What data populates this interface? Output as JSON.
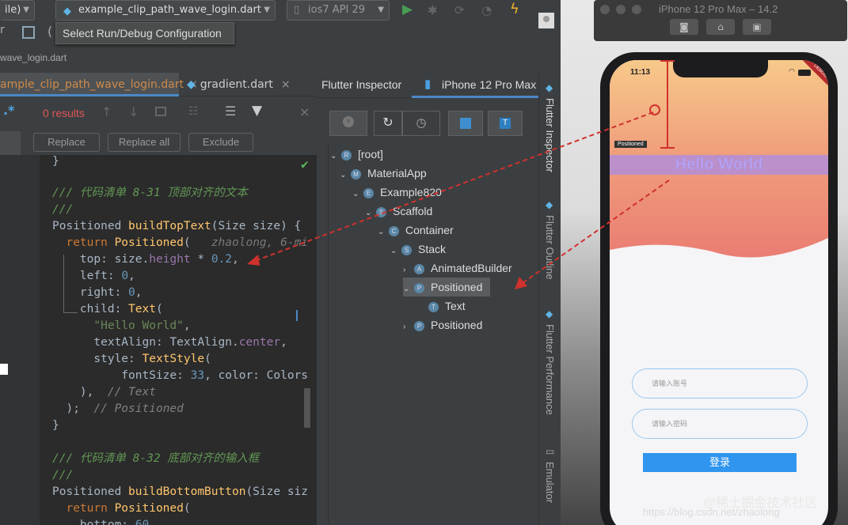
{
  "toolbar": {
    "run_config_label": "ile)",
    "file_combo": "example_clip_path_wave_login.dart",
    "device_combo": "ios7 API 29",
    "tooltip": "Select Run/Debug Configuration"
  },
  "breadcrumb": "wave_login.dart",
  "editor_tabs": [
    "ample_clip_path_wave_login.dart",
    "gradient.dart"
  ],
  "find": {
    "results": "0 results",
    "replace": "Replace",
    "replace_all": "Replace all",
    "exclude": "Exclude"
  },
  "code": {
    "l0": "}",
    "l1": "/// 代码清单 8-31 顶部对齐的文本",
    "l2": "///",
    "l3a": "Positioned ",
    "l3b": "buildTopText",
    "l3c": "(Size size) {",
    "l4a": "  return ",
    "l4b": "Positioned",
    "l4c": "(   ",
    "l4d": "zhaolong, 6-mi",
    "l5a": "    top: ",
    "l5b": "size.",
    "l5c": "height",
    " l5d": " * ",
    "l5e": "0.2",
    ",": ",",
    "l6a": "    left: ",
    "l6b": "0",
    "l7a": "    right: ",
    "l7b": "0",
    "l8a": "    child: ",
    "l8b": "Text",
    "l8c": "(",
    "l9": "      \"Hello World\"",
    "l10a": "      textAlign: TextAlign.",
    "l10b": "center",
    "l11a": "      style: ",
    "l11b": "TextStyle",
    "l11c": "(",
    "l12a": "          fontSize: ",
    "l12b": "33",
    ", color: Colors": "",
    "l13a": "    ),  ",
    "l13b": "// Text",
    "l14a": "  );  ",
    "l14b": "// Positioned",
    "l15": "}",
    "l16": "/// 代码清单 8-32 底部对齐的输入框",
    "l17": "///",
    "l18a": "Positioned ",
    "l18b": "buildBottomButton",
    "l18c": "(Size siz",
    "l19a": "  return ",
    "l19b": "Positioned",
    "l19c": "(",
    "l20a": "    bottom: ",
    "l20b": "60"
  },
  "inspector": {
    "tab1": "Flutter Inspector",
    "tab2": "iPhone 12 Pro Max",
    "tree": [
      "[root]",
      "MaterialApp",
      "Example820",
      "Scaffold",
      "Container",
      "Stack",
      "AnimatedBuilder",
      "Positioned",
      "Text",
      "Positioned"
    ],
    "icons": [
      "R",
      "M",
      "E",
      "S",
      "C",
      "S",
      "A",
      "P",
      "T",
      "P"
    ]
  },
  "side_tabs": [
    "Flutter Inspector",
    "Flutter Outline",
    "Flutter Performance",
    "Emulator"
  ],
  "simulator": {
    "title": "iPhone 12 Pro Max – 14.2",
    "time": "11:13",
    "debug": "DEBUG",
    "positioned_tag": "Positioned",
    "hello": "Hello World",
    "account_placeholder": "请输入账号",
    "password_placeholder": "请输入密码",
    "login": "登录",
    "watermark1": "@稀土掘金技术社区",
    "watermark2": "https://blog.csdn.net/zhaolong"
  }
}
